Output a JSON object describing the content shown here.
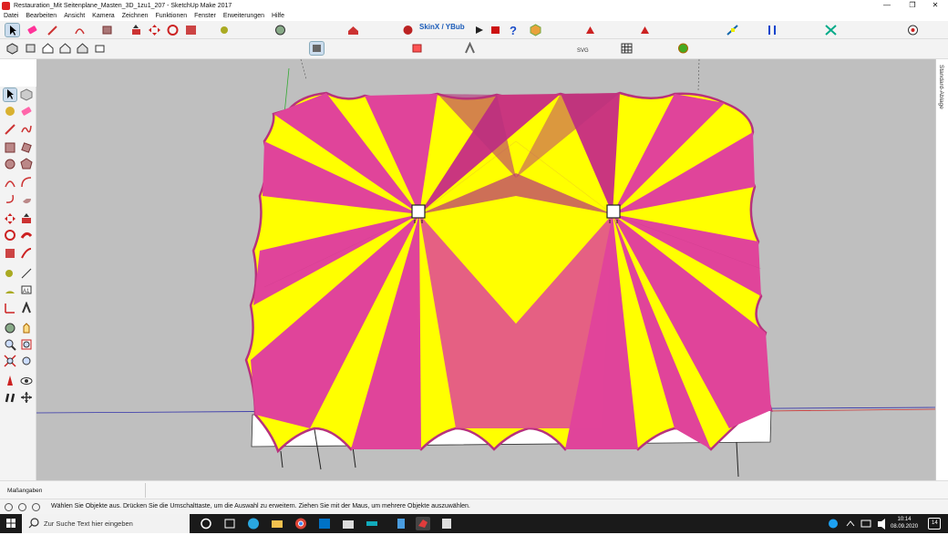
{
  "window": {
    "title": "Restauration_Mit Seitenplane_Masten_3D_1zu1_207 - SketchUp Make 2017",
    "minimize": "—",
    "maximize": "❐",
    "close": "✕"
  },
  "menu": [
    "Datei",
    "Bearbeiten",
    "Ansicht",
    "Kamera",
    "Zeichnen",
    "Funktionen",
    "Fenster",
    "Erweiterungen",
    "Hilfe"
  ],
  "toolbar": {
    "skinx_label": "SkinX / YBub"
  },
  "sidepanel": {
    "label": "Standard-Ablage"
  },
  "measurements": {
    "label": "Maßangaben",
    "value": ""
  },
  "status": {
    "message": "Wählen Sie Objekte aus. Drücken Sie die Umschalttaste, um die Auswahl zu erweitern. Ziehen Sie mit der Maus, um mehrere Objekte auszuwählen."
  },
  "taskbar": {
    "search_placeholder": "Zur Suche Text hier eingeben",
    "time": "10:14",
    "date": "08.09.2020",
    "notification_count": "14"
  },
  "colors": {
    "tent_pink": "#e0449a",
    "tent_pink_dark": "#b8327c",
    "tent_yellow": "#ffff00",
    "tent_yellow_dark": "#e6e600",
    "viewport_bg": "#bfbfbf"
  }
}
